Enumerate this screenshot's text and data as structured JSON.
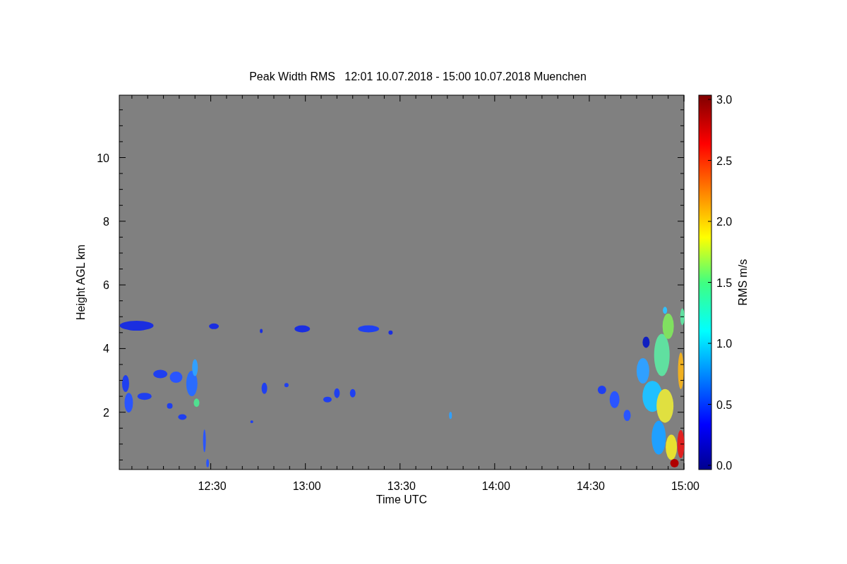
{
  "title": "Peak Width RMS   12:01 10.07.2018 - 15:00 10.07.2018 Muenchen",
  "y_axis": {
    "label": "Height AGL km",
    "ticks": [
      "10",
      "8",
      "6",
      "4",
      "2"
    ]
  },
  "x_axis": {
    "label": "Time UTC",
    "ticks": [
      "12:30",
      "13:00",
      "13:30",
      "14:00",
      "14:30",
      "15:00"
    ]
  },
  "colorbar": {
    "label": "RMS m/s",
    "ticks": [
      "3.0",
      "2.5",
      "2.0",
      "1.5",
      "1.0",
      "0.5",
      "0.0"
    ]
  }
}
